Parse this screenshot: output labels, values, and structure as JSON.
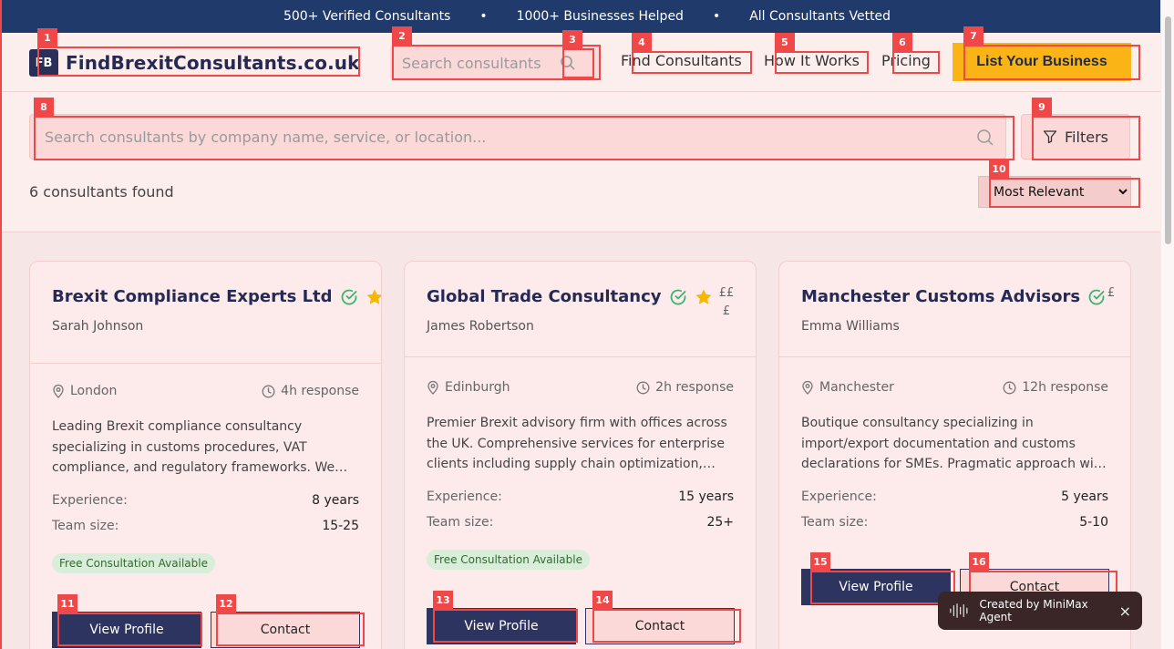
{
  "announce": {
    "item1": "500+ Verified Consultants",
    "sep": "•",
    "item2": "1000+ Businesses Helped",
    "item3": "All Consultants Vetted"
  },
  "header": {
    "logo_badge": "FB",
    "logo_text": "FindBrexitConsultants.co.uk",
    "search_placeholder": "Search consultants",
    "nav": [
      "Find Consultants",
      "How It Works",
      "Pricing"
    ],
    "cta": "List Your Business"
  },
  "filter": {
    "search_placeholder": "Search consultants by company name, service, or location...",
    "filters_label": "Filters",
    "found_text": "6 consultants found",
    "sort_selected": "Most Relevant"
  },
  "cards": [
    {
      "name": "Brexit Compliance Experts Ltd",
      "person": "Sarah Johnson",
      "price": "£££",
      "location": "London",
      "response": "4h response",
      "description": "Leading Brexit compliance consultancy specializing in customs procedures, VAT compliance, and regulatory frameworks. We…",
      "experience_label": "Experience:",
      "experience": "8 years",
      "team_label": "Team size:",
      "team": "15-25",
      "free": "Free Consultation Available",
      "view": "View Profile",
      "contact": "Contact"
    },
    {
      "name": "Global Trade Consultancy",
      "person": "James Robertson",
      "price": "£££",
      "location": "Edinburgh",
      "response": "2h response",
      "description": "Premier Brexit advisory firm with offices across the UK. Comprehensive services for enterprise clients including supply chain optimization,…",
      "experience_label": "Experience:",
      "experience": "15 years",
      "team_label": "Team size:",
      "team": "25+",
      "free": "Free Consultation Available",
      "view": "View Profile",
      "contact": "Contact"
    },
    {
      "name": "Manchester Customs Advisors",
      "person": "Emma Williams",
      "price": "£",
      "location": "Manchester",
      "response": "12h response",
      "description": "Boutique consultancy specializing in import/export documentation and customs declarations for SMEs. Pragmatic approach wi…",
      "experience_label": "Experience:",
      "experience": "5 years",
      "team_label": "Team size:",
      "team": "5-10",
      "view": "View Profile",
      "contact": "Contact"
    }
  ],
  "markers": [
    "1",
    "2",
    "3",
    "4",
    "5",
    "6",
    "7",
    "8",
    "9",
    "10",
    "11",
    "12",
    "13",
    "14",
    "15",
    "16"
  ],
  "toast": {
    "text": "Created by MiniMax Agent",
    "close": "×"
  },
  "colors": {
    "navy": "#1f3a6b",
    "cta": "#fbb416",
    "marker": "#f04848",
    "check": "#3cb371",
    "star": "#f5b800"
  }
}
